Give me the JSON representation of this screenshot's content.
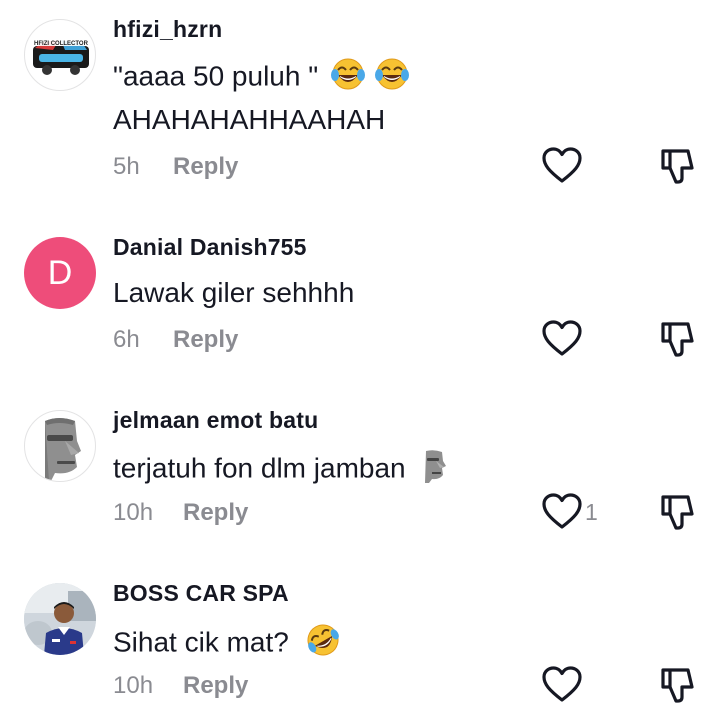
{
  "comments": [
    {
      "username": "hfizi_hzrn",
      "avatar_icon": "hfizi-collector-car-logo",
      "avatar_text": "HFIZI COLLECTOR",
      "lines": [
        "\"aaaa 50 puluh \"",
        "AHAHAHAHHAAHAH"
      ],
      "emojis": [
        "tears-of-joy",
        "tears-of-joy"
      ],
      "time": "5h",
      "reply_label": "Reply",
      "like_count": ""
    },
    {
      "username": "Danial Danish755",
      "avatar_letter": "D",
      "avatar_color": "#ee4d7a",
      "lines": [
        "Lawak giler sehhhh"
      ],
      "time": "6h",
      "reply_label": "Reply",
      "like_count": ""
    },
    {
      "username": "jelmaan emot batu",
      "avatar_icon": "moai-icon",
      "lines": [
        "terjatuh fon dlm jamban"
      ],
      "emojis": [
        "moai"
      ],
      "time": "10h",
      "reply_label": "Reply",
      "like_count": "1"
    },
    {
      "username": "BOSS CAR SPA",
      "avatar_icon": "person-photo",
      "lines": [
        "Sihat cik mat?"
      ],
      "emojis": [
        "rolling-on-floor-laughing"
      ],
      "time": "10h",
      "reply_label": "Reply",
      "like_count": ""
    }
  ],
  "colors": {
    "text": "#161823",
    "secondary": "#8a8b91"
  }
}
